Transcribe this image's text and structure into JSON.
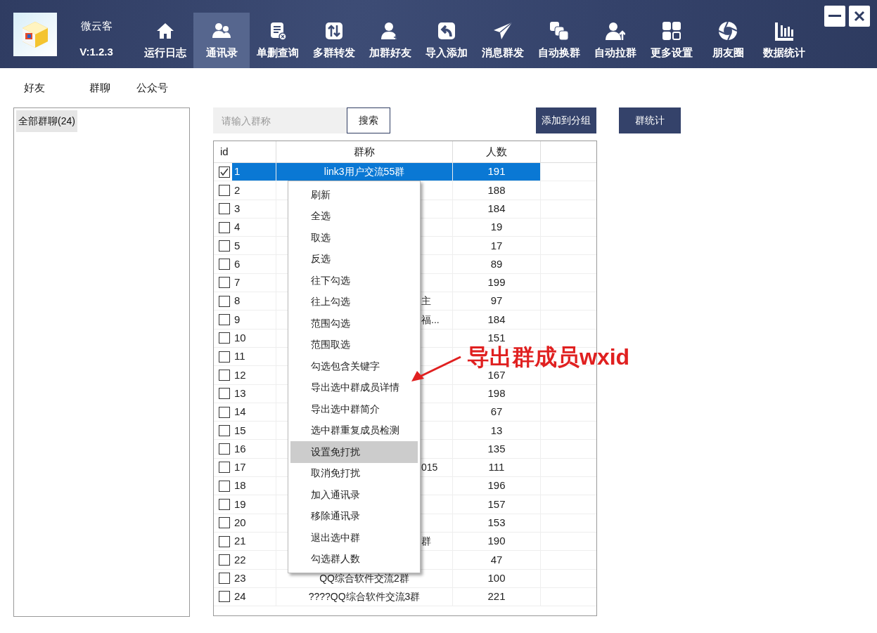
{
  "app": {
    "name": "微云客",
    "version": "V:1.2.3"
  },
  "toolbar": [
    {
      "label": "运行日志",
      "selected": false
    },
    {
      "label": "通讯录",
      "selected": true
    },
    {
      "label": "单删查询",
      "selected": false
    },
    {
      "label": "多群转发",
      "selected": false
    },
    {
      "label": "加群好友",
      "selected": false
    },
    {
      "label": "导入添加",
      "selected": false
    },
    {
      "label": "消息群发",
      "selected": false
    },
    {
      "label": "自动换群",
      "selected": false
    },
    {
      "label": "自动拉群",
      "selected": false
    },
    {
      "label": "更多设置",
      "selected": false
    },
    {
      "label": "朋友圈",
      "selected": false
    },
    {
      "label": "数据统计",
      "selected": false
    }
  ],
  "subtabs": [
    {
      "label": "好友",
      "selected": false
    },
    {
      "label": "群聊",
      "selected": true
    },
    {
      "label": "公众号",
      "selected": false
    }
  ],
  "sidebar": {
    "items": [
      {
        "label": "全部群聊(24)",
        "selected": true
      }
    ]
  },
  "search": {
    "placeholder": "请输入群称",
    "button": "搜索"
  },
  "actions": [
    "添加到分组",
    "群统计"
  ],
  "table": {
    "columns": [
      "id",
      "群称",
      "人数"
    ],
    "rows": [
      {
        "id": "1",
        "checked": true,
        "selected": true,
        "name": "link3用户交流55群",
        "count": "191"
      },
      {
        "id": "2",
        "checked": false,
        "selected": false,
        "count": "188"
      },
      {
        "id": "3",
        "checked": false,
        "selected": false,
        "count": "184"
      },
      {
        "id": "4",
        "checked": false,
        "selected": false,
        "count": "19"
      },
      {
        "id": "5",
        "checked": false,
        "selected": false,
        "count": "17"
      },
      {
        "id": "6",
        "checked": false,
        "selected": false,
        "count": "89"
      },
      {
        "id": "7",
        "checked": false,
        "selected": false,
        "count": "199"
      },
      {
        "id": "8",
        "checked": false,
        "selected": false,
        "name": "主",
        "count": "97"
      },
      {
        "id": "9",
        "checked": false,
        "selected": false,
        "name": "福...",
        "count": "184"
      },
      {
        "id": "10",
        "checked": false,
        "selected": false,
        "count": "151"
      },
      {
        "id": "11",
        "checked": false,
        "selected": false
      },
      {
        "id": "12",
        "checked": false,
        "selected": false,
        "count": "167"
      },
      {
        "id": "13",
        "checked": false,
        "selected": false,
        "count": "198"
      },
      {
        "id": "14",
        "checked": false,
        "selected": false,
        "count": "67"
      },
      {
        "id": "15",
        "checked": false,
        "selected": false,
        "count": "13"
      },
      {
        "id": "16",
        "checked": false,
        "selected": false,
        "count": "135"
      },
      {
        "id": "17",
        "checked": false,
        "selected": false,
        "name": "015",
        "count": "111"
      },
      {
        "id": "18",
        "checked": false,
        "selected": false,
        "count": "196"
      },
      {
        "id": "19",
        "checked": false,
        "selected": false,
        "count": "157"
      },
      {
        "id": "20",
        "checked": false,
        "selected": false,
        "count": "153"
      },
      {
        "id": "21",
        "checked": false,
        "selected": false,
        "name": "群",
        "count": "190"
      },
      {
        "id": "22",
        "checked": false,
        "selected": false,
        "count": "47"
      },
      {
        "id": "23",
        "checked": false,
        "selected": false,
        "name": "QQ综合软件交流2群",
        "count": "100"
      },
      {
        "id": "24",
        "checked": false,
        "selected": false,
        "name": "????QQ综合软件交流3群",
        "count": "221"
      }
    ]
  },
  "context_menu": [
    {
      "label": "刷新",
      "selected": false
    },
    {
      "label": "全选",
      "selected": false
    },
    {
      "label": "取选",
      "selected": false
    },
    {
      "label": "反选",
      "selected": false
    },
    {
      "label": "往下勾选",
      "selected": false
    },
    {
      "label": "往上勾选",
      "selected": false
    },
    {
      "label": "范围勾选",
      "selected": false
    },
    {
      "label": "范围取选",
      "selected": false
    },
    {
      "label": "勾选包含关键字",
      "selected": false
    },
    {
      "label": "导出选中群成员详情",
      "selected": false
    },
    {
      "label": "导出选中群简介",
      "selected": false
    },
    {
      "label": "选中群重复成员检测",
      "selected": false
    },
    {
      "label": "设置免打扰",
      "selected": true
    },
    {
      "label": "取消免打扰",
      "selected": false
    },
    {
      "label": "加入通讯录",
      "selected": false
    },
    {
      "label": "移除通讯录",
      "selected": false
    },
    {
      "label": "退出选中群",
      "selected": false
    },
    {
      "label": "勾选群人数",
      "selected": false
    }
  ],
  "annotation": {
    "text": "导出群成员wxid"
  }
}
